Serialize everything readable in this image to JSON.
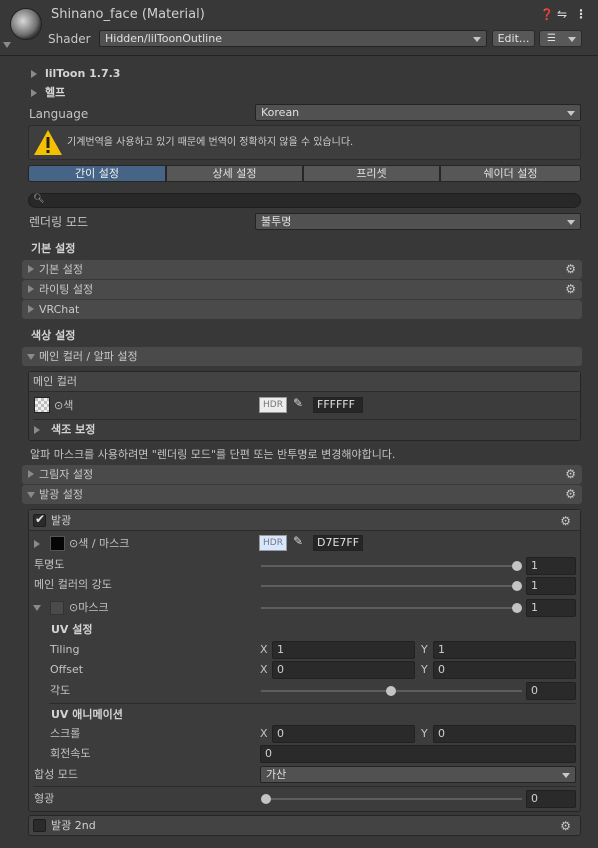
{
  "header": {
    "title": "Shinano_face (Material)",
    "shader_label": "Shader",
    "shader_value": "Hidden/lilToonOutline",
    "edit_label": "Edit...",
    "icons": [
      "help-icon",
      "preset-icon",
      "menu-icon"
    ]
  },
  "foldouts": {
    "liltoon": "lilToon 1.7.3",
    "help": "헬프"
  },
  "language": {
    "label": "Language",
    "value": "Korean"
  },
  "warning": "기계번역을 사용하고 있기 때문에 번역이 정확하지 않을 수 있습니다.",
  "tabs": [
    {
      "label": "간이 설정",
      "active": true
    },
    {
      "label": "상세 설정",
      "active": false
    },
    {
      "label": "프리셋",
      "active": false
    },
    {
      "label": "쉐이더 설정",
      "active": false
    }
  ],
  "search": {
    "placeholder": ""
  },
  "rendering": {
    "label": "렌더링 모드",
    "value": "불투명"
  },
  "basic": {
    "title": "기본 설정",
    "items": [
      "기본 설정",
      "라이팅 설정",
      "VRChat"
    ]
  },
  "color": {
    "title": "색상 설정",
    "main_header": "메인 컬러 / 알파 설정",
    "main_color_title": "메인 컬러",
    "color_label": "⊙색",
    "hdr": "HDR",
    "color_hex": "FFFFFF",
    "color_correction": "색조 보정",
    "alpha_note": "알파 마스크를 사용하려면 \"렌더링 모드\"를 단편 또는 반투명로 변경해야합니다.",
    "shadow_header": "그림자 설정",
    "emission_header": "발광 설정"
  },
  "emission": {
    "toggle_label": "발광",
    "color_mask_label": "⊙색 / 마스크",
    "hdr": "HDR",
    "hex": "D7E7FF",
    "transparency_label": "투명도",
    "transparency_value": "1",
    "main_intensity_label": "메인 컬러의 강도",
    "main_intensity_value": "1",
    "mask_label": "⊙마스크",
    "mask_value": "1",
    "uv_title": "UV 설정",
    "tiling_label": "Tiling",
    "tiling_x": "1",
    "tiling_y": "1",
    "offset_label": "Offset",
    "offset_x": "0",
    "offset_y": "0",
    "angle_label": "각도",
    "angle_value": "0",
    "uv_anim_title": "UV 애니메이션",
    "scroll_label": "스크롤",
    "scroll_x": "0",
    "scroll_y": "0",
    "rotation_label": "회전속도",
    "rotation_value": "0",
    "blend_label": "합성 모드",
    "blend_value": "가산",
    "fluor_label": "형광",
    "fluor_value": "0",
    "x": "X",
    "y": "Y"
  },
  "emission2": {
    "label": "발광 2nd"
  }
}
